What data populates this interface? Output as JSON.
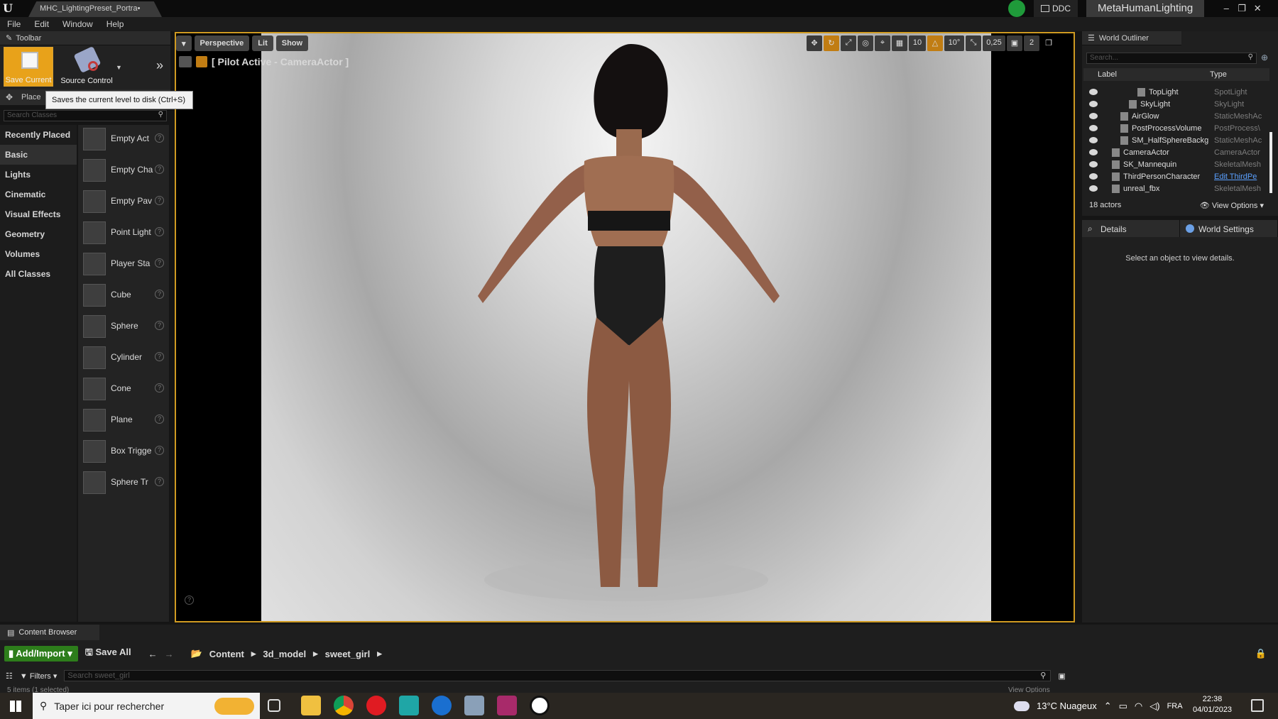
{
  "titlebar": {
    "tab_title": "MHC_LightingPreset_Portra•",
    "ddc_label": "DDC",
    "project_name": "MetaHumanLighting"
  },
  "menu": [
    "File",
    "Edit",
    "Window",
    "Help"
  ],
  "toolbar": {
    "tab_label": "Toolbar",
    "save_label": "Save Current",
    "source_control_label": "Source Control"
  },
  "place": {
    "tab_label": "Place",
    "tooltip": "Saves the current level to disk (Ctrl+S)",
    "search_placeholder": "Search Classes",
    "categories": [
      "Recently Placed",
      "Basic",
      "Lights",
      "Cinematic",
      "Visual Effects",
      "Geometry",
      "Volumes",
      "All Classes"
    ],
    "active_category": "Basic",
    "classes": [
      "Empty Act",
      "Empty Cha",
      "Empty Pav",
      "Point Light",
      "Player Sta",
      "Cube",
      "Sphere",
      "Cylinder",
      "Cone",
      "Plane",
      "Box Trigge",
      "Sphere Tr"
    ]
  },
  "viewport": {
    "perspective_label": "Perspective",
    "lit_label": "Lit",
    "show_label": "Show",
    "pilot_text": "[ Pilot Active - CameraActor ]",
    "grid_snap": "10",
    "rotation_snap": "10°",
    "scale_snap": "0,25",
    "camera_speed": "2"
  },
  "outliner": {
    "tab_label": "World Outliner",
    "search_placeholder": "Search...",
    "col_label": "Label",
    "col_type": "Type",
    "rows": [
      {
        "label": "TopLight",
        "type": "SpotLight",
        "indent": 3
      },
      {
        "label": "SkyLight",
        "type": "SkyLight",
        "indent": 2
      },
      {
        "label": "AirGlow",
        "type": "StaticMeshAc",
        "indent": 1
      },
      {
        "label": "PostProcessVolume",
        "type": "PostProcess\\",
        "indent": 1
      },
      {
        "label": "SM_HalfSphereBackg",
        "type": "StaticMeshAc",
        "indent": 1
      },
      {
        "label": "CameraActor",
        "type": "CameraActor",
        "indent": 0
      },
      {
        "label": "SK_Mannequin",
        "type": "SkeletalMesh",
        "indent": 0
      },
      {
        "label": "ThirdPersonCharacter",
        "type": "Edit ThirdPe",
        "indent": 0,
        "link": true
      },
      {
        "label": "unreal_fbx",
        "type": "SkeletalMesh",
        "indent": 0
      }
    ],
    "actor_count": "18 actors",
    "view_options": "View Options"
  },
  "details": {
    "tab_details": "Details",
    "tab_world_settings": "World Settings",
    "empty_text": "Select an object to view details."
  },
  "content_browser": {
    "tab_label": "Content Browser",
    "add_import": "Add/Import",
    "save_all": "Save All",
    "breadcrumb": [
      "Content",
      "3d_model",
      "sweet_girl"
    ],
    "filters": "Filters",
    "search_placeholder": "Search sweet_girl",
    "status": "5 items (1 selected)",
    "view_options": "View Options"
  },
  "taskbar": {
    "search_placeholder": "Taper ici pour rechercher",
    "weather": "13°C  Nuageux",
    "lang": "FRA",
    "time": "22:38",
    "date": "04/01/2023"
  },
  "colors": {
    "accent": "#cf9a21",
    "add_green": "#2d7d1b",
    "link": "#5aa0ff"
  }
}
